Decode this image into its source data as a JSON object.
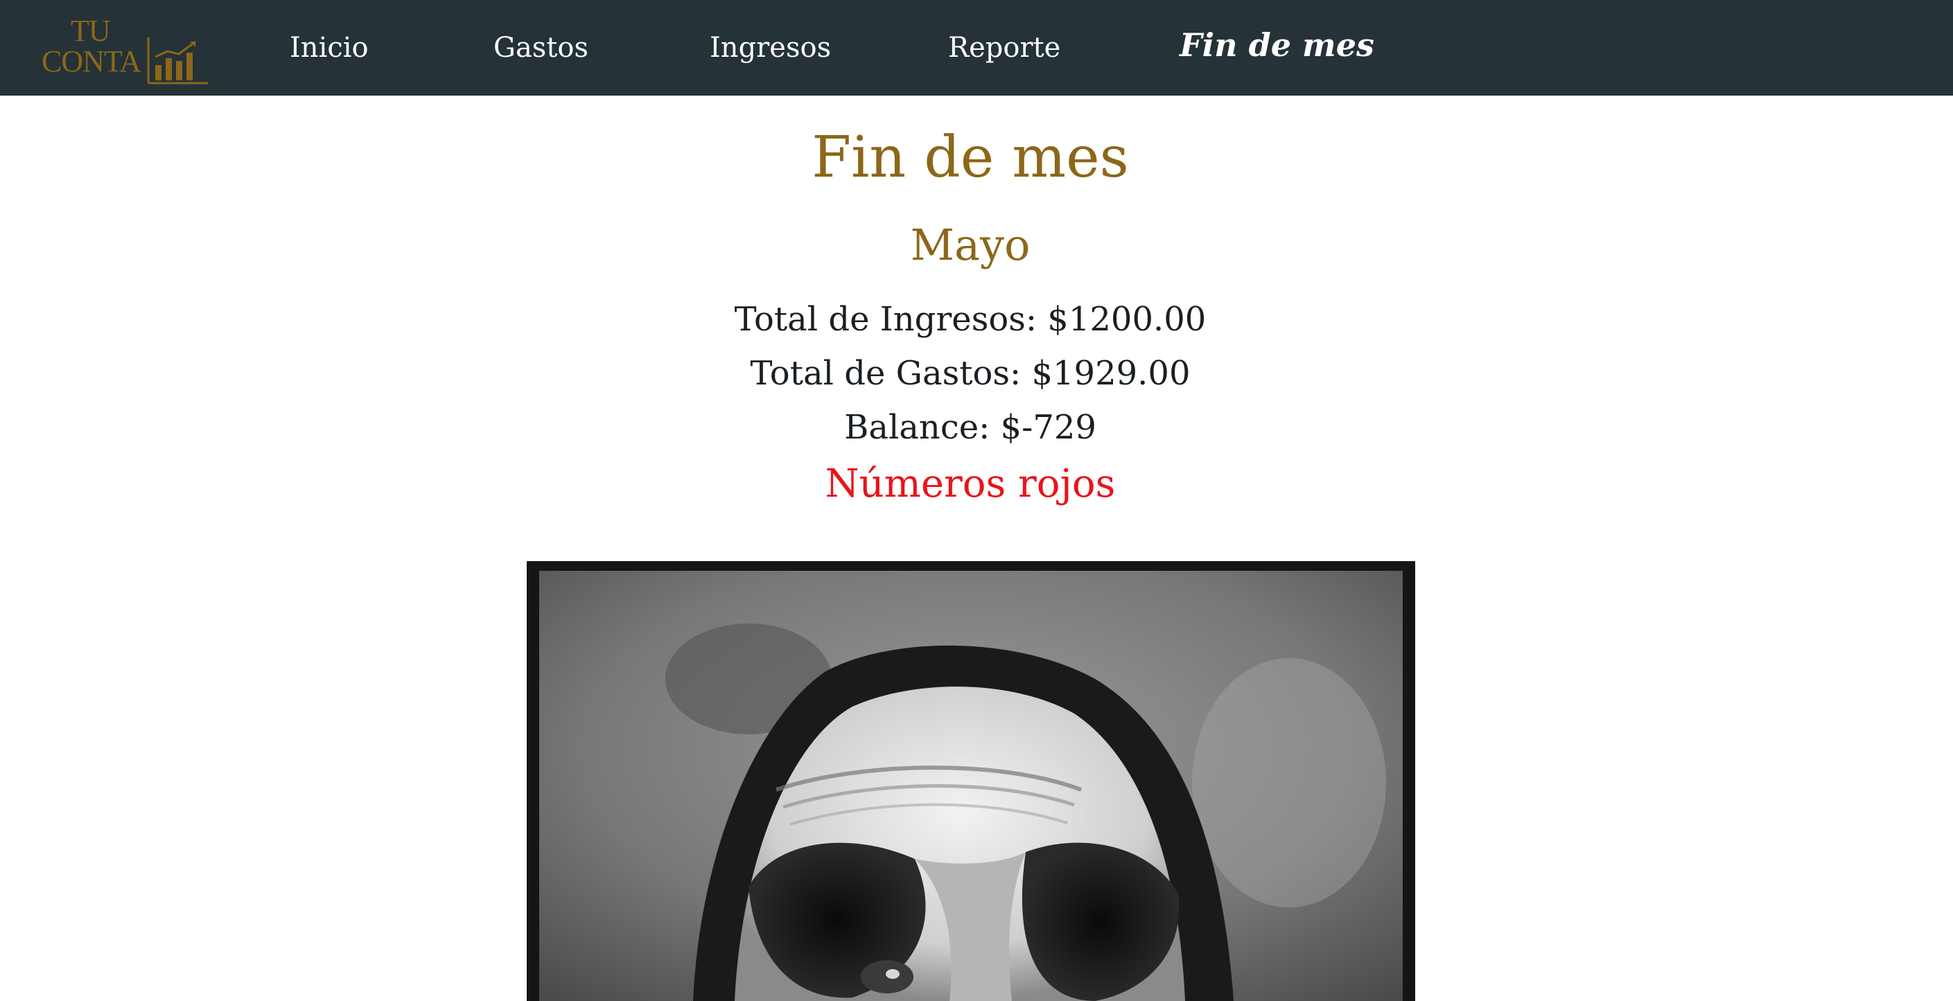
{
  "brand": {
    "line1": "TU",
    "line2": "CONTA",
    "color": "#8c6719"
  },
  "nav": {
    "items": [
      {
        "label": "Inicio"
      },
      {
        "label": "Gastos"
      },
      {
        "label": "Ingresos"
      },
      {
        "label": "Reporte"
      },
      {
        "label": "Fin de mes",
        "active": true
      }
    ],
    "background": "#253237"
  },
  "page": {
    "title": "Fin de mes",
    "month": "Mayo",
    "total_income": "Total de Ingresos: $1200.00",
    "total_expenses": "Total de Gastos: $1929.00",
    "balance": "Balance: $-729",
    "status": "Números rojos",
    "status_color": "#e8141b"
  },
  "image": {
    "icon": "grayscale-face-photo"
  }
}
